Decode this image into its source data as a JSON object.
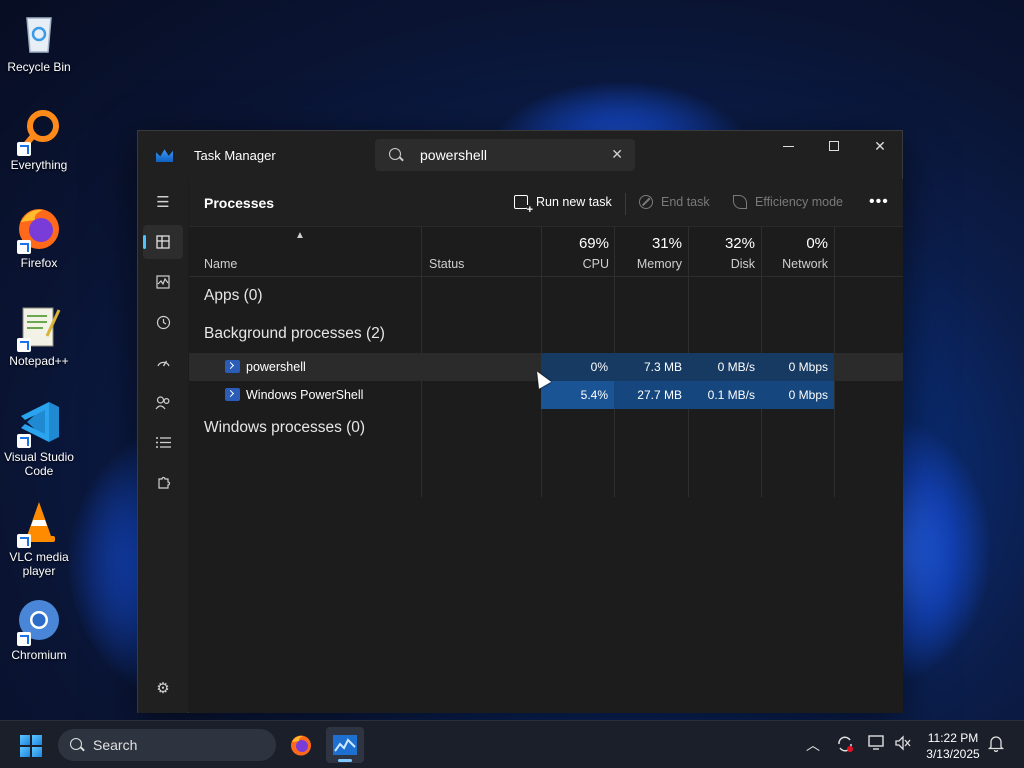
{
  "desktop": {
    "icons": [
      {
        "label": "Recycle Bin"
      },
      {
        "label": "Everything"
      },
      {
        "label": "Firefox"
      },
      {
        "label": "Notepad++"
      },
      {
        "label": "Visual Studio Code"
      },
      {
        "label": "VLC media player"
      },
      {
        "label": "Chromium"
      }
    ]
  },
  "window": {
    "title": "Task Manager",
    "search_value": "powershell",
    "page_title": "Processes",
    "toolbar": {
      "run_new_task": "Run new task",
      "end_task": "End task",
      "efficiency_mode": "Efficiency mode",
      "more": "•••"
    },
    "columns": {
      "name": "Name",
      "status": "Status",
      "cpu": {
        "label": "CPU",
        "pct": "69%"
      },
      "memory": {
        "label": "Memory",
        "pct": "31%"
      },
      "disk": {
        "label": "Disk",
        "pct": "32%"
      },
      "network": {
        "label": "Network",
        "pct": "0%"
      }
    },
    "groups": {
      "apps": "Apps (0)",
      "background": "Background processes (2)",
      "windows": "Windows processes (0)"
    },
    "processes": [
      {
        "name": "powershell",
        "cpu": "0%",
        "memory": "7.3 MB",
        "disk": "0 MB/s",
        "network": "0 Mbps"
      },
      {
        "name": "Windows PowerShell",
        "cpu": "5.4%",
        "memory": "27.7 MB",
        "disk": "0.1 MB/s",
        "network": "0 Mbps"
      }
    ]
  },
  "taskbar": {
    "search_label": "Search",
    "time": "11:22 PM",
    "date": "3/13/2025"
  },
  "colors": {
    "accent": "#4cc2ff",
    "window_bg": "#1c1c1c",
    "heat_low": "#173a63",
    "heat_mid": "#1a5494"
  }
}
